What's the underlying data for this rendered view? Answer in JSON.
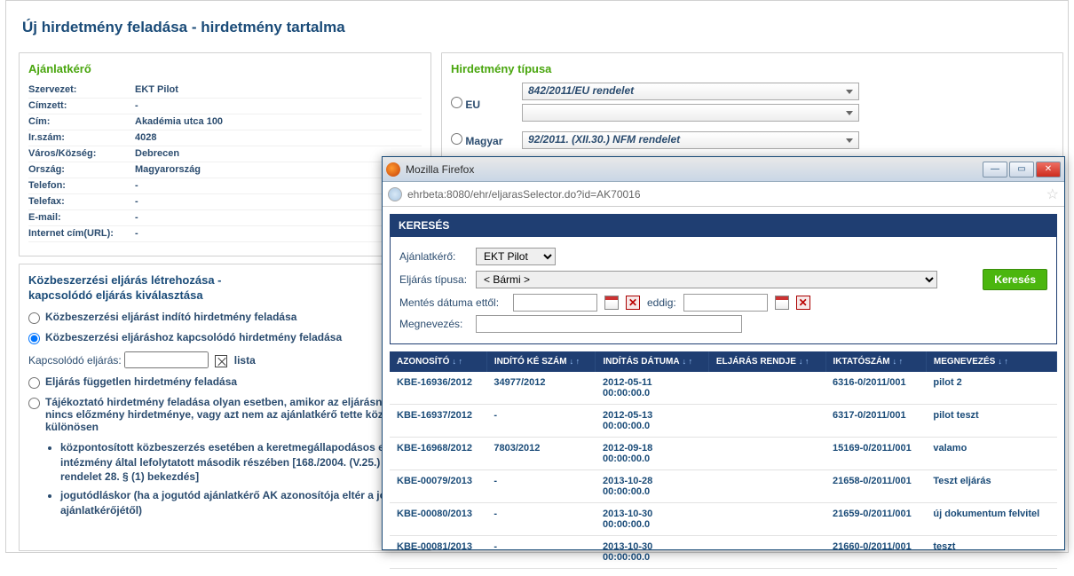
{
  "page_title": "Új hirdetmény feladása - hirdetmény tartalma",
  "ajanlatkero": {
    "title": "Ajánlatkérő",
    "rows": {
      "szervezet": {
        "k": "Szervezet:",
        "v": "EKT Pilot"
      },
      "cimzett": {
        "k": "Címzett:",
        "v": "-"
      },
      "cim": {
        "k": "Cím:",
        "v": "Akadémia utca 100"
      },
      "irszam": {
        "k": "Ir.szám:",
        "v": "4028"
      },
      "varos": {
        "k": "Város/Község:",
        "v": "Debrecen"
      },
      "orszag": {
        "k": "Ország:",
        "v": "Magyarország"
      },
      "telefon": {
        "k": "Telefon:",
        "v": "-"
      },
      "telefax": {
        "k": "Telefax:",
        "v": "-"
      },
      "email": {
        "k": "E-mail:",
        "v": "-"
      },
      "url": {
        "k": "Internet cím(URL):",
        "v": "-"
      }
    }
  },
  "hirdetmeny_tipusa": {
    "title": "Hirdetmény típusa",
    "eu_label": "EU",
    "eu_value": "842/2011/EU rendelet",
    "magyar_label": "Magyar",
    "magyar_value": "92/2011. (XII.30.) NFM rendelet"
  },
  "procedure": {
    "title_l1": "Közbeszerzési eljárás létrehozása -",
    "title_l2": "kapcsolódó eljárás kiválasztása",
    "opt1": "Közbeszerzési eljárást indító hirdetmény feladása",
    "opt2": "Közbeszerzési eljáráshoz kapcsolódó hirdetmény feladása",
    "kapcsolodo_label": "Kapcsolódó eljárás:",
    "lista_link": "lista",
    "opt3": "Eljárás független hirdetmény feladása",
    "opt4": "Tájékoztató hirdetmény feladása olyan esetben, amikor az eljárásnak nincs előzmény hirdetménye, vagy azt nem az ajánlatkérő tette közzé, így különösen",
    "bullet1": "központosított közbeszerzés esetében a keretmegállapodásos eljárás intézmény által lefolytatott második részében [168./2004. (V.25.) Korm. rendelet 28. § (1) bekezdés]",
    "bullet2": "jogutódláskor (ha a jogutód ajánlatkérő AK azonosítója eltér a jogelőd ajánlatkérőjétől)"
  },
  "popup": {
    "window_title": "Mozilla Firefox",
    "url": "ehrbeta:8080/ehr/eljarasSelector.do?id=AK70016",
    "search_header": "KERESÉS",
    "ajanlatkero_label": "Ajánlatkérő:",
    "ajanlatkero_value": "EKT Pilot",
    "eljaras_tipusa_label": "Eljárás típusa:",
    "eljaras_tipusa_value": "< Bármi >",
    "date_from_label": "Mentés dátuma ettől:",
    "date_to_label": "eddig:",
    "megnevezes_label": "Megnevezés:",
    "search_button": "Keresés",
    "headers": {
      "azonosito": "AZONOSÍTÓ",
      "indito_ke": "INDÍTÓ KÉ SZÁM",
      "inditas_datuma": "INDÍTÁS DÁTUMA",
      "eljaras_rendje": "ELJÁRÁS RENDJE",
      "iktatoszam": "IKTATÓSZÁM",
      "megnevezes": "MEGNEVEZÉS"
    },
    "rows": [
      {
        "id": "KBE-16936/2012",
        "ke": "34977/2012",
        "date": "2012-05-11 00:00:00.0",
        "rend": "",
        "iktato": "6316-0/2011/001",
        "meg": "pilot 2"
      },
      {
        "id": "KBE-16937/2012",
        "ke": "-",
        "date": "2012-05-13 00:00:00.0",
        "rend": "",
        "iktato": "6317-0/2011/001",
        "meg": "pilot teszt"
      },
      {
        "id": "KBE-16968/2012",
        "ke": "7803/2012",
        "date": "2012-09-18 00:00:00.0",
        "rend": "",
        "iktato": "15169-0/2011/001",
        "meg": "valamo"
      },
      {
        "id": "KBE-00079/2013",
        "ke": "-",
        "date": "2013-10-28 00:00:00.0",
        "rend": "",
        "iktato": "21658-0/2011/001",
        "meg": "Teszt eljárás"
      },
      {
        "id": "KBE-00080/2013",
        "ke": "-",
        "date": "2013-10-30 00:00:00.0",
        "rend": "",
        "iktato": "21659-0/2011/001",
        "meg": "új dokumentum felvitel"
      },
      {
        "id": "KBE-00081/2013",
        "ke": "-",
        "date": "2013-10-30 00:00:00.0",
        "rend": "",
        "iktato": "21660-0/2011/001",
        "meg": "teszt"
      }
    ]
  }
}
